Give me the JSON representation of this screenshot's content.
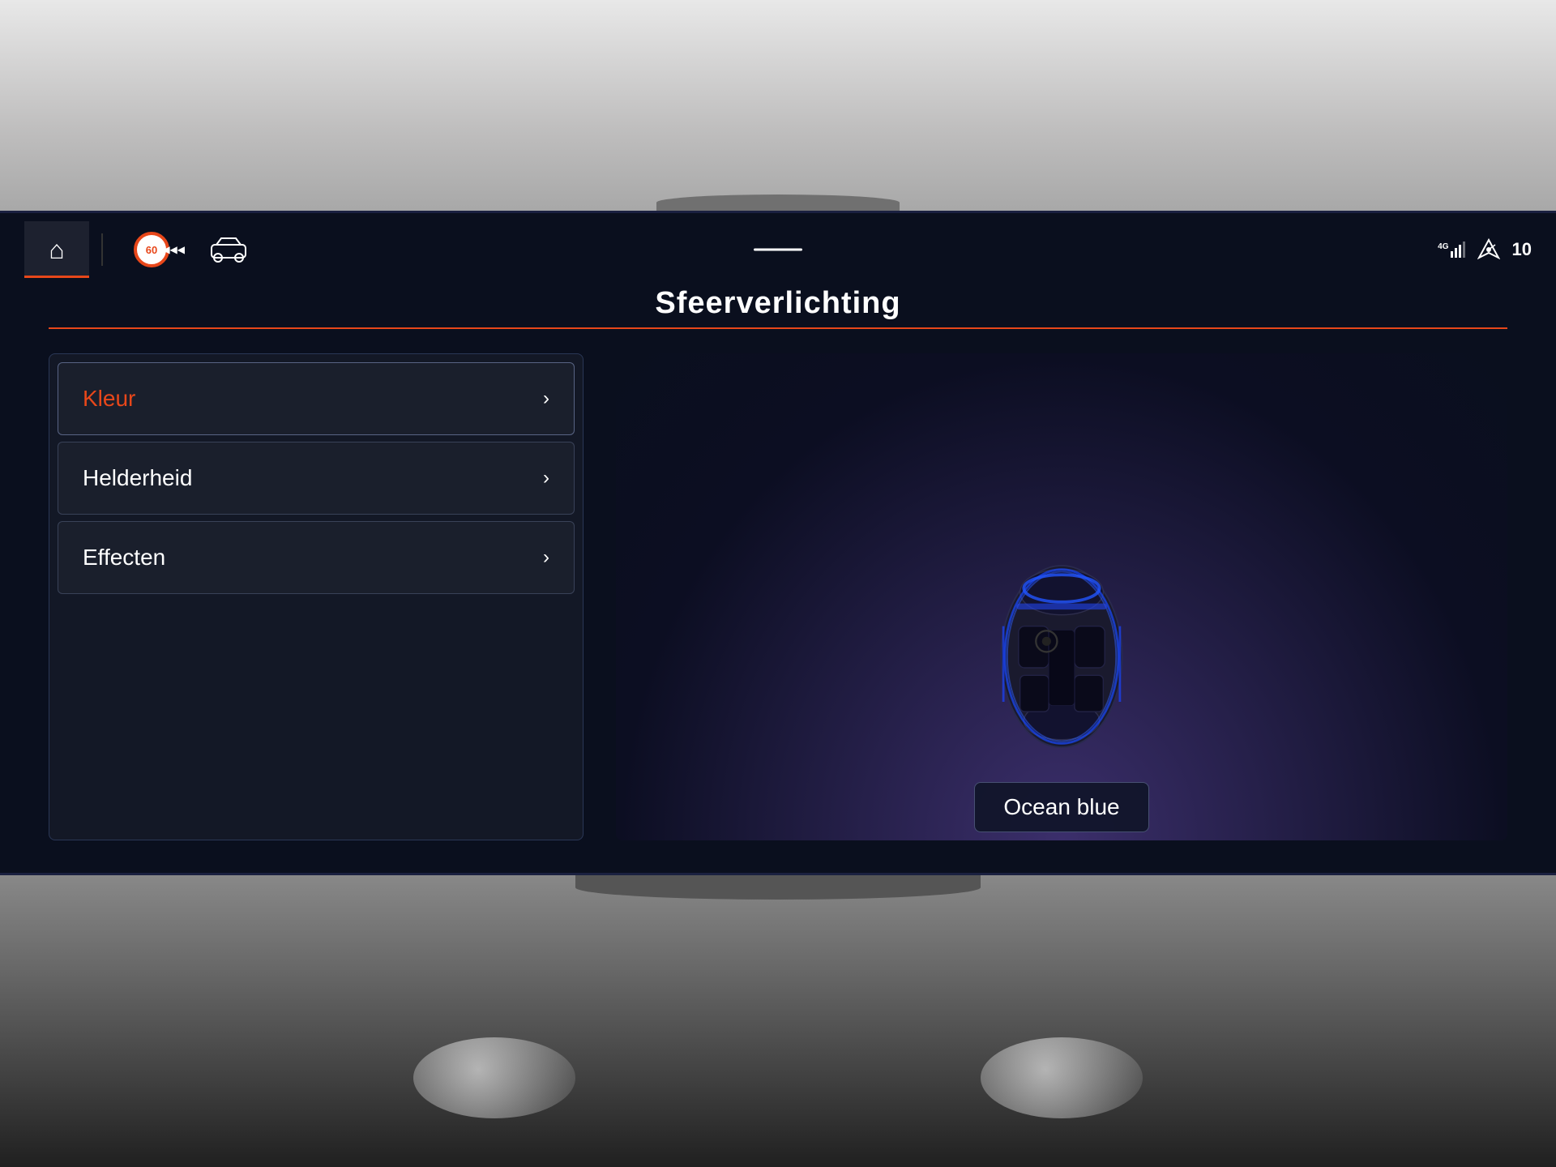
{
  "top_area": {
    "bg_color": "#c8c8c8"
  },
  "nav": {
    "home_icon": "⌂",
    "speed_limit": "60",
    "car_icon": "🚗",
    "center_dash": "—",
    "signal_label": "4G",
    "nav_speed": "10",
    "signal_superscript": "4G"
  },
  "page": {
    "title": "Sfeerverlichting",
    "title_underline_color": "#e8471a"
  },
  "menu": {
    "items": [
      {
        "label": "Kleur",
        "active": true
      },
      {
        "label": "Helderheid",
        "active": false
      },
      {
        "label": "Effecten",
        "active": false
      }
    ],
    "arrow": "›"
  },
  "preview": {
    "color_name": "Ocean blue",
    "light_color": "#3a3aff"
  }
}
